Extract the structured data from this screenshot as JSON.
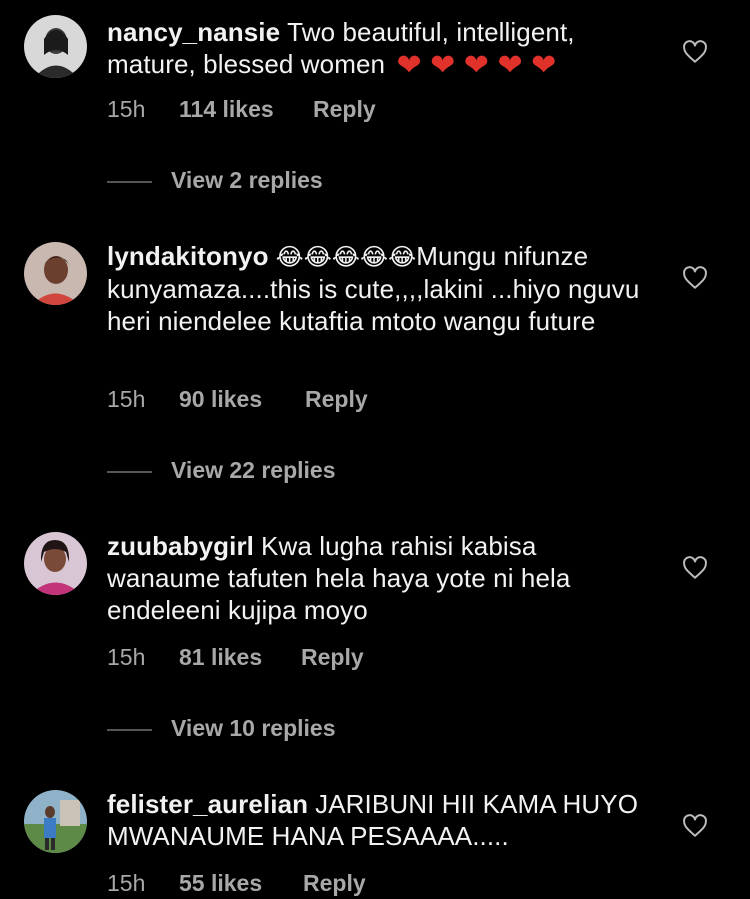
{
  "comments": [
    {
      "username": "nancy_nansie",
      "text": "Two beautiful, intelligent, mature, blessed women",
      "emoji": "❤ ❤ ❤ ❤ ❤",
      "time": "15h",
      "likes": "114 likes",
      "reply_label": "Reply",
      "view_replies": "View 2 replies"
    },
    {
      "username": "lyndakitonyo",
      "emoji": "😂😂😂😂😂",
      "text": "Mungu nifunze kunyamaza....this is cute,,,,lakini ...hiyo nguvu heri niendelee kutaftia mtoto wangu future",
      "time": "15h",
      "likes": "90 likes",
      "reply_label": "Reply",
      "view_replies": "View 22 replies"
    },
    {
      "username": "zuubabygirl",
      "text": "Kwa lugha rahisi kabisa wanaume tafuten hela haya yote ni hela endeleeni kujipa moyo",
      "time": "15h",
      "likes": "81 likes",
      "reply_label": "Reply",
      "view_replies": "View 10 replies"
    },
    {
      "username": "felister_aurelian",
      "text": "JARIBUNI HII KAMA HUYO MWANAUME HANA PESAAAA.....",
      "time": "15h",
      "likes": "55 likes",
      "reply_label": "Reply"
    }
  ],
  "colors": {
    "background": "#000000",
    "text": "#f2f2f2",
    "meta": "#a8a8a8",
    "heart": "#e0312b"
  },
  "icons": [
    "heart-outline-icon",
    "heart-emoji-icon",
    "laughing-emoji-icon"
  ]
}
